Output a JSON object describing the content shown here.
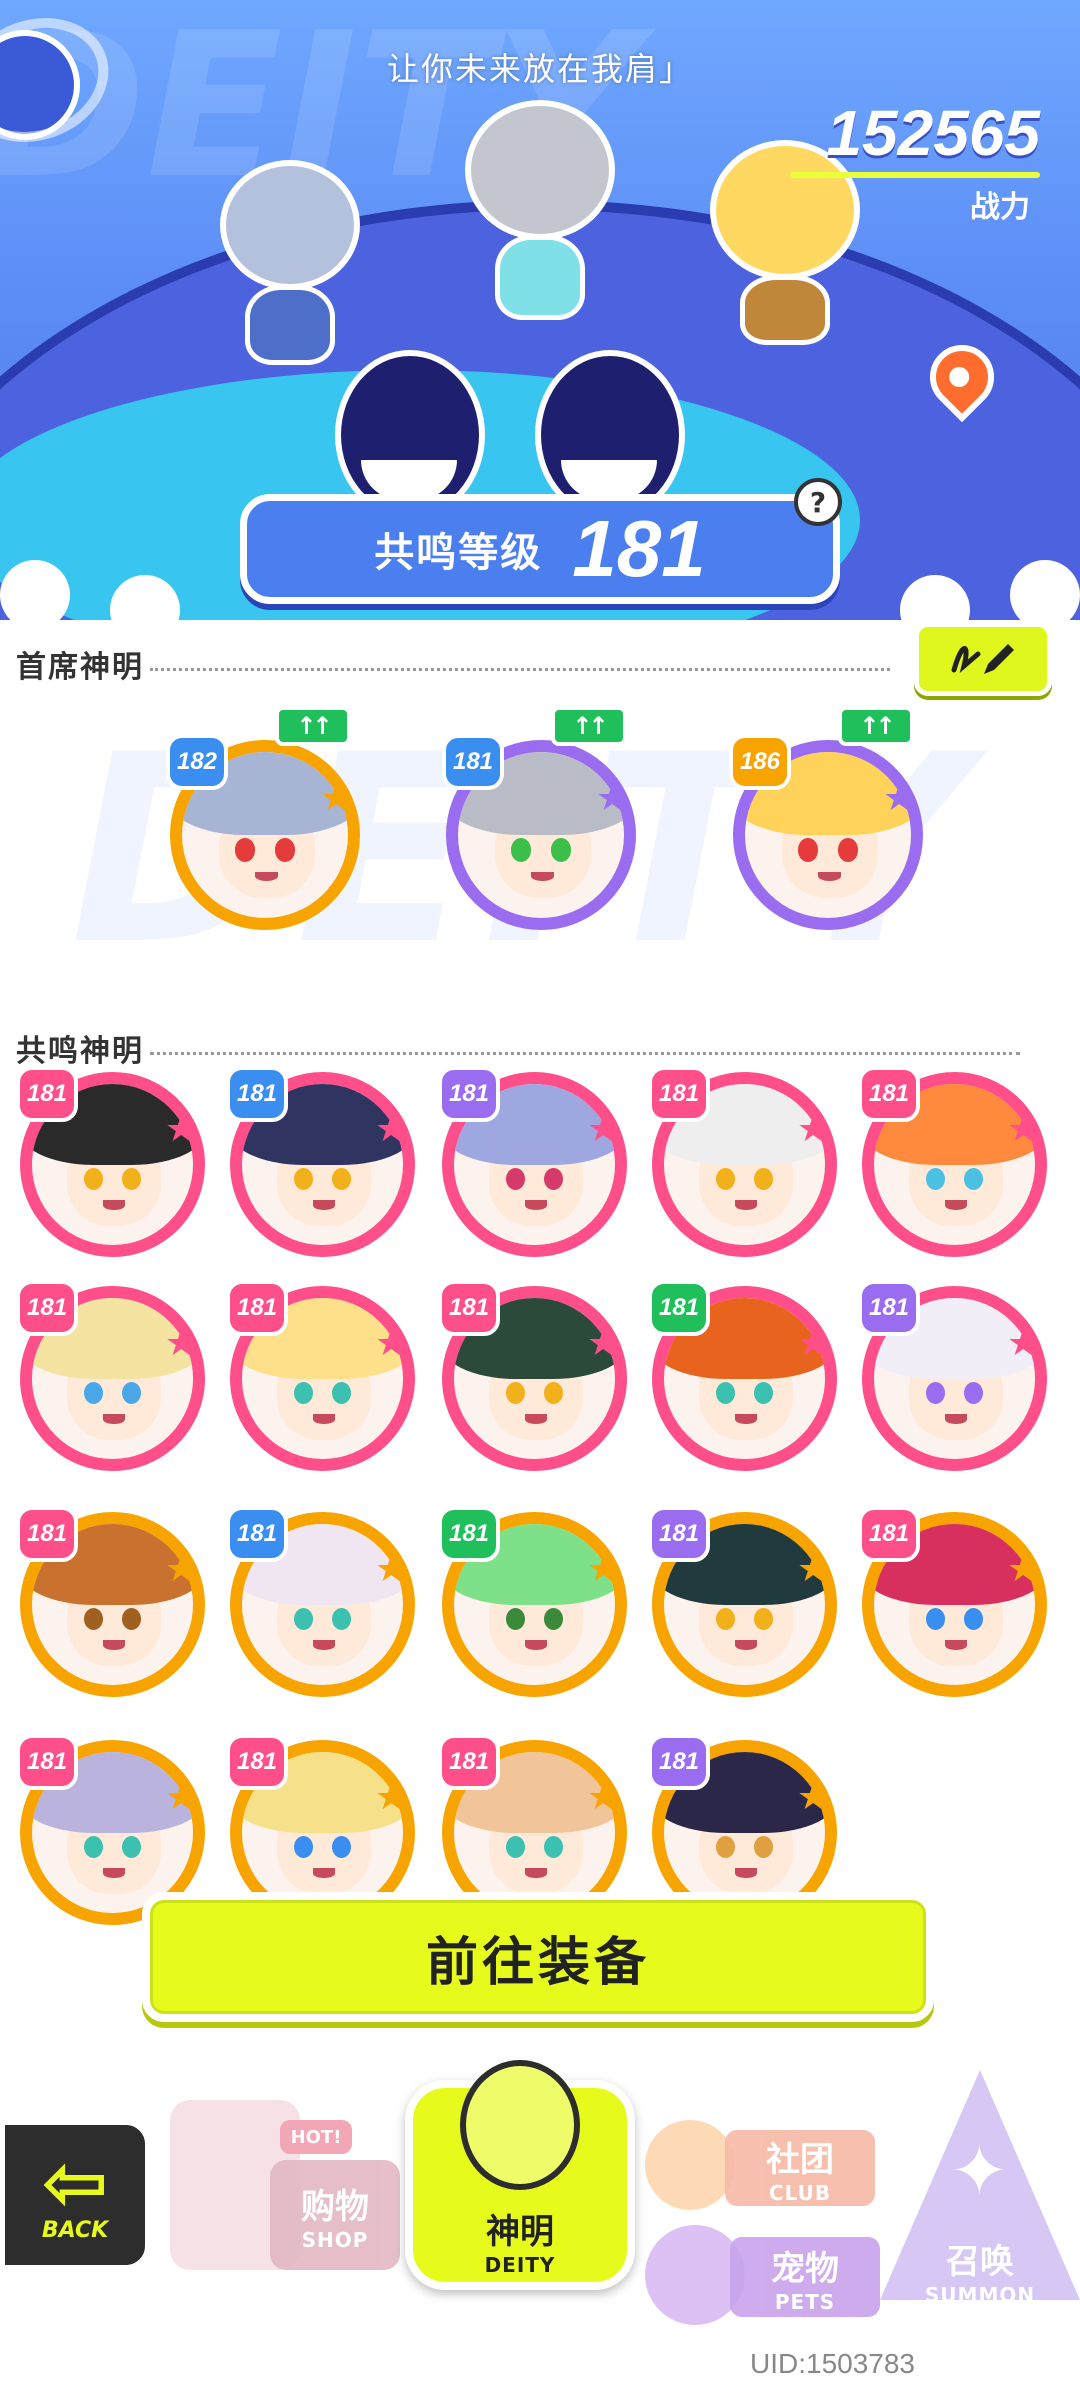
{
  "header": {
    "slogan": "让你未来放在我肩」",
    "power_value": "152565",
    "power_label": "战力",
    "bg_word": "DEITY",
    "resonance_label": "共鸣等级",
    "resonance_level": "181",
    "help_symbol": "?"
  },
  "chief": {
    "title": "首席神明",
    "edit_icon": "pencil-icon",
    "deities": [
      {
        "level": "182",
        "up": "↑↑",
        "hair": "#a7b4d4",
        "ring": "#f7a400",
        "badge": "#3a8ef0",
        "eye": "#e63b3b"
      },
      {
        "level": "181",
        "up": "↑↑",
        "hair": "#b9bcc6",
        "ring": "#9a6cf0",
        "badge": "#3a8ef0",
        "eye": "#3cbf4a"
      },
      {
        "level": "186",
        "up": "↑↑",
        "hair": "#ffd35a",
        "ring": "#9a6cf0",
        "badge": "#f7a400",
        "eye": "#e63b3b"
      }
    ]
  },
  "resonance": {
    "title": "共鸣神明",
    "rows": [
      [
        {
          "level": "181",
          "hair": "#2a2a2a",
          "ring": "#ff4f8a",
          "badge": "#ff4f8a",
          "eye": "#f2b01b"
        },
        {
          "level": "181",
          "hair": "#2f3560",
          "ring": "#ff4f8a",
          "badge": "#3a8ef0",
          "eye": "#f2b01b"
        },
        {
          "level": "181",
          "hair": "#9ea7e0",
          "ring": "#ff4f8a",
          "badge": "#9a6cf0",
          "eye": "#d63a6a"
        },
        {
          "level": "181",
          "hair": "#eeeeee",
          "ring": "#ff4f8a",
          "badge": "#ff4f8a",
          "eye": "#f2b01b"
        },
        {
          "level": "181",
          "hair": "#ff8a3d",
          "ring": "#ff4f8a",
          "badge": "#ff4f8a",
          "eye": "#4cc0e0"
        }
      ],
      [
        {
          "level": "181",
          "hair": "#f5e3a1",
          "ring": "#ff4f8a",
          "badge": "#ff4f8a",
          "eye": "#4aa8e8"
        },
        {
          "level": "181",
          "hair": "#ffe08a",
          "ring": "#ff4f8a",
          "badge": "#ff4f8a",
          "eye": "#3cc0b0"
        },
        {
          "level": "181",
          "hair": "#2b4a3a",
          "ring": "#ff4f8a",
          "badge": "#ff4f8a",
          "eye": "#f2b01b"
        },
        {
          "level": "181",
          "hair": "#e8641e",
          "ring": "#ff4f8a",
          "badge": "#1fbf5b",
          "eye": "#3cc0b0"
        },
        {
          "level": "181",
          "hair": "#f1eef7",
          "ring": "#ff4f8a",
          "badge": "#9a6cf0",
          "eye": "#9a6cf0"
        }
      ],
      [
        {
          "level": "181",
          "hair": "#c9712e",
          "ring": "#f7a400",
          "badge": "#ff4f8a",
          "eye": "#a06020"
        },
        {
          "level": "181",
          "hair": "#f0e6f2",
          "ring": "#f7a400",
          "badge": "#3a8ef0",
          "eye": "#3cc0b0"
        },
        {
          "level": "181",
          "hair": "#7fe08a",
          "ring": "#f7a400",
          "badge": "#1fbf5b",
          "eye": "#3a8a3a"
        },
        {
          "level": "181",
          "hair": "#213a3e",
          "ring": "#f7a400",
          "badge": "#9a6cf0",
          "eye": "#f2b01b"
        },
        {
          "level": "181",
          "hair": "#d7305f",
          "ring": "#f7a400",
          "badge": "#ff4f8a",
          "eye": "#3a8ef0"
        }
      ],
      [
        {
          "level": "181",
          "hair": "#b9b3dd",
          "ring": "#f7a400",
          "badge": "#ff4f8a",
          "eye": "#3cc0b0"
        },
        {
          "level": "181",
          "hair": "#f6e08a",
          "ring": "#f7a400",
          "badge": "#ff4f8a",
          "eye": "#3a8ef0"
        },
        {
          "level": "181",
          "hair": "#f2c49a",
          "ring": "#f7a400",
          "badge": "#ff4f8a",
          "eye": "#3cc0b0"
        },
        {
          "level": "181",
          "hair": "#2a2748",
          "ring": "#f7a400",
          "badge": "#9a6cf0",
          "eye": "#e0a040"
        }
      ]
    ]
  },
  "actions": {
    "go_equip": "前往装备"
  },
  "nav": {
    "back_label": "BACK",
    "back_icon": "arrow-left-icon",
    "hot_badge": "HOT!",
    "tabs": {
      "shop": {
        "zh": "购物",
        "en": "SHOP"
      },
      "deity": {
        "zh": "神明",
        "en": "DEITY"
      },
      "club": {
        "zh": "社团",
        "en": "CLUB"
      },
      "pets": {
        "zh": "宠物",
        "en": "PETS"
      },
      "summon": {
        "zh": "召唤",
        "en": "SUMMON"
      }
    }
  },
  "uid": "UID:1503783",
  "colors": {
    "accent_lime": "#e6fb1c",
    "header_blue": "#5d8ef6",
    "up_green": "#1fbf5b"
  }
}
